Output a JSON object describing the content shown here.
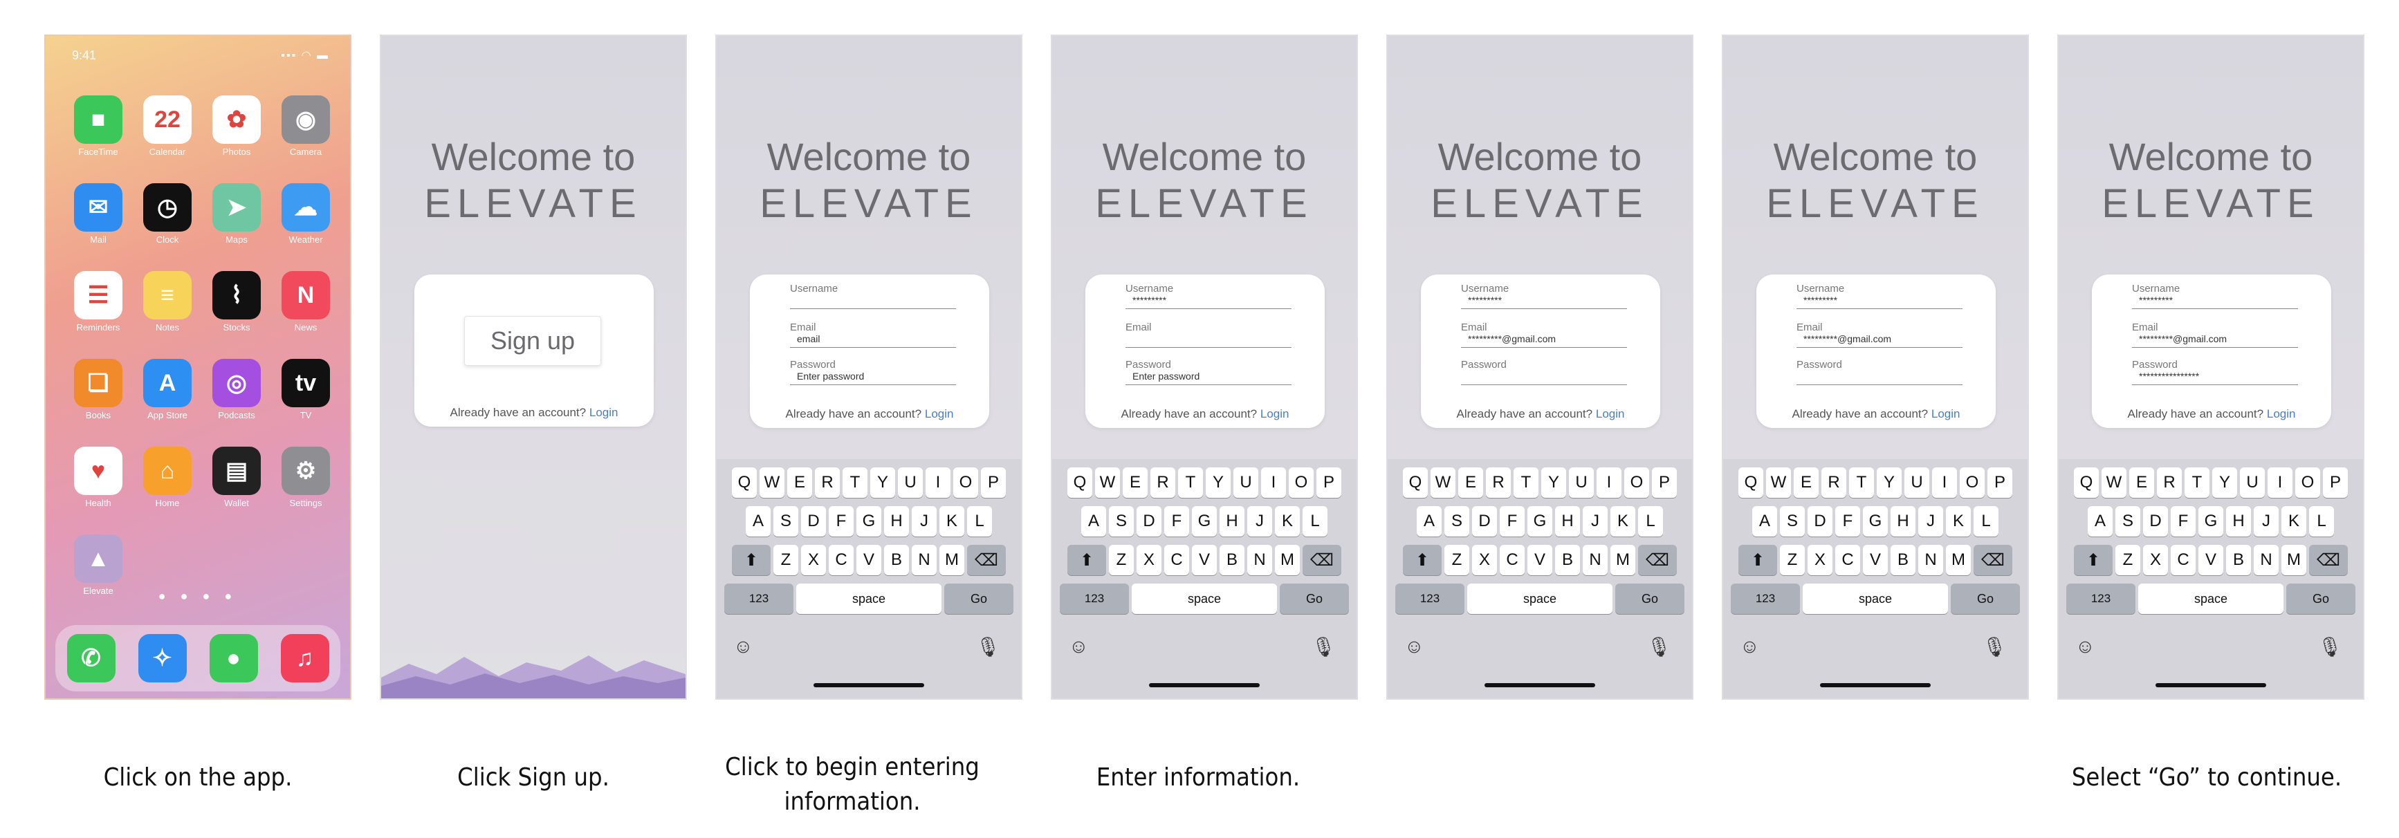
{
  "home": {
    "status_time": "9:41",
    "apps": [
      {
        "label": "FaceTime",
        "icon": "facetime-icon",
        "glyph": "■",
        "color": "#3bc75a"
      },
      {
        "label": "Calendar",
        "icon": "calendar-icon",
        "glyph": "22",
        "color": "#ffffff"
      },
      {
        "label": "Photos",
        "icon": "photos-icon",
        "glyph": "✿",
        "color": "#ffffff"
      },
      {
        "label": "Camera",
        "icon": "camera-icon",
        "glyph": "◉",
        "color": "#8d8d92"
      },
      {
        "label": "Mail",
        "icon": "mail-icon",
        "glyph": "✉",
        "color": "#2f8cf0"
      },
      {
        "label": "Clock",
        "icon": "clock-icon",
        "glyph": "◷",
        "color": "#111111"
      },
      {
        "label": "Maps",
        "icon": "maps-icon",
        "glyph": "➤",
        "color": "#6fc6a2"
      },
      {
        "label": "Weather",
        "icon": "weather-icon",
        "glyph": "☁",
        "color": "#3d9bf2"
      },
      {
        "label": "Reminders",
        "icon": "reminders-icon",
        "glyph": "☰",
        "color": "#ffffff"
      },
      {
        "label": "Notes",
        "icon": "notes-icon",
        "glyph": "≡",
        "color": "#f7d35a"
      },
      {
        "label": "Stocks",
        "icon": "stocks-icon",
        "glyph": "⌇",
        "color": "#111111"
      },
      {
        "label": "News",
        "icon": "news-icon",
        "glyph": "N",
        "color": "#f04a5c"
      },
      {
        "label": "Books",
        "icon": "books-icon",
        "glyph": "❏",
        "color": "#f08a2a"
      },
      {
        "label": "App Store",
        "icon": "app-store-icon",
        "glyph": "A",
        "color": "#2d8ff2"
      },
      {
        "label": "Podcasts",
        "icon": "podcasts-icon",
        "glyph": "◎",
        "color": "#a44fe0"
      },
      {
        "label": "TV",
        "icon": "tv-icon",
        "glyph": "tv",
        "color": "#111111"
      },
      {
        "label": "Health",
        "icon": "health-icon",
        "glyph": "♥",
        "color": "#ffffff"
      },
      {
        "label": "Home",
        "icon": "home-icon",
        "glyph": "⌂",
        "color": "#f7a12c"
      },
      {
        "label": "Wallet",
        "icon": "wallet-icon",
        "glyph": "▤",
        "color": "#222222"
      },
      {
        "label": "Settings",
        "icon": "settings-icon",
        "glyph": "⚙",
        "color": "#8e8e93"
      },
      {
        "label": "Elevate",
        "icon": "elevate-icon",
        "glyph": "▲",
        "color": "#b9a2cf"
      }
    ],
    "dock": [
      {
        "icon": "phone-icon",
        "glyph": "✆",
        "color": "#3bc75a"
      },
      {
        "icon": "safari-icon",
        "glyph": "✧",
        "color": "#2f8cf0"
      },
      {
        "icon": "messages-icon",
        "glyph": "●",
        "color": "#3bc75a"
      },
      {
        "icon": "music-icon",
        "glyph": "♫",
        "color": "#f2405b"
      }
    ]
  },
  "welcome": {
    "line1": "Welcome to",
    "line2": "ELEVATE"
  },
  "signup": {
    "button": "Sign up"
  },
  "already": {
    "text": "Already have an account?",
    "login": "Login"
  },
  "form": {
    "username_label": "Username",
    "email_label": "Email",
    "password_label": "Password",
    "email_placeholder": "email",
    "password_placeholder": "Enter password",
    "username_value": "*********",
    "email_value_partial": "*********@gmail.com",
    "password_value": "****************"
  },
  "keyboard": {
    "row1": [
      "Q",
      "W",
      "E",
      "R",
      "T",
      "Y",
      "U",
      "I",
      "O",
      "P"
    ],
    "row2": [
      "A",
      "S",
      "D",
      "F",
      "G",
      "H",
      "J",
      "K",
      "L"
    ],
    "row3": [
      "Z",
      "X",
      "C",
      "V",
      "B",
      "N",
      "M"
    ],
    "num": "123",
    "space": "space",
    "go": "Go"
  },
  "captions": [
    "Click on the app.",
    "Click Sign up.",
    "Click to begin entering information.",
    "Enter information.",
    "Select “Go” to continue."
  ]
}
